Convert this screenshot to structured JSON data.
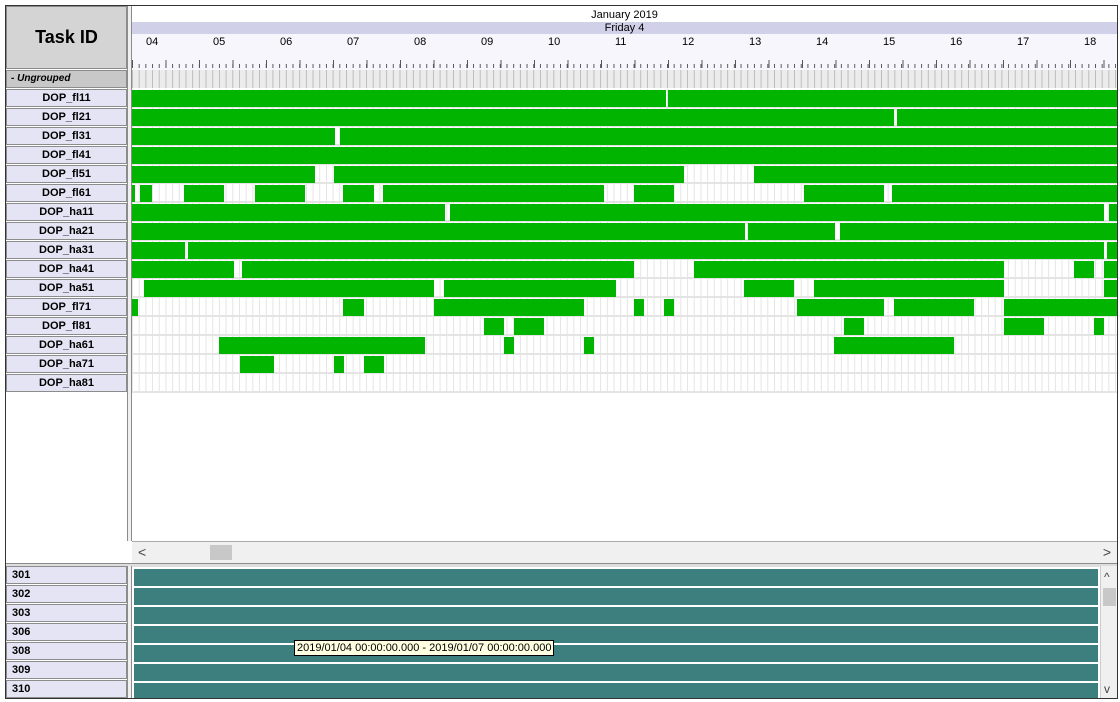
{
  "header": {
    "task_id_label": "Task ID"
  },
  "timeline": {
    "month": "January 2019",
    "day": "Friday 4",
    "hours": [
      "04",
      "05",
      "06",
      "07",
      "08",
      "09",
      "10",
      "11",
      "12",
      "13",
      "14",
      "15",
      "16",
      "17",
      "18"
    ]
  },
  "group": {
    "label": "- Ungrouped"
  },
  "tasks": [
    {
      "id": "DOP_fl11",
      "bars": [
        [
          0,
          534
        ],
        [
          536,
          985
        ]
      ]
    },
    {
      "id": "DOP_fl21",
      "bars": [
        [
          0,
          762
        ],
        [
          765,
          985
        ]
      ]
    },
    {
      "id": "DOP_fl31",
      "bars": [
        [
          0,
          203
        ],
        [
          208,
          985
        ]
      ]
    },
    {
      "id": "DOP_fl41",
      "bars": [
        [
          0,
          985
        ]
      ]
    },
    {
      "id": "DOP_fl51",
      "bars": [
        [
          0,
          183
        ],
        [
          202,
          552
        ],
        [
          622,
          985
        ]
      ]
    },
    {
      "id": "DOP_fl61",
      "bars": [
        [
          0,
          3
        ],
        [
          8,
          20
        ],
        [
          52,
          92
        ],
        [
          123,
          173
        ],
        [
          211,
          242
        ],
        [
          251,
          472
        ],
        [
          502,
          542
        ],
        [
          672,
          752
        ],
        [
          760,
          985
        ]
      ]
    },
    {
      "id": "DOP_ha11",
      "bars": [
        [
          0,
          313
        ],
        [
          318,
          972
        ],
        [
          977,
          985
        ]
      ]
    },
    {
      "id": "DOP_ha21",
      "bars": [
        [
          0,
          613
        ],
        [
          616,
          703
        ],
        [
          708,
          985
        ]
      ]
    },
    {
      "id": "DOP_ha31",
      "bars": [
        [
          0,
          53
        ],
        [
          56,
          972
        ],
        [
          975,
          985
        ]
      ]
    },
    {
      "id": "DOP_ha41",
      "bars": [
        [
          0,
          102
        ],
        [
          110,
          502
        ],
        [
          562,
          872
        ],
        [
          942,
          962
        ],
        [
          972,
          985
        ]
      ]
    },
    {
      "id": "DOP_ha51",
      "bars": [
        [
          12,
          302
        ],
        [
          312,
          484
        ],
        [
          612,
          662
        ],
        [
          682,
          872
        ],
        [
          972,
          985
        ]
      ]
    },
    {
      "id": "DOP_fl71",
      "bars": [
        [
          0,
          6
        ],
        [
          211,
          232
        ],
        [
          302,
          452
        ],
        [
          502,
          512
        ],
        [
          532,
          542
        ],
        [
          665,
          752
        ],
        [
          762,
          842
        ],
        [
          872,
          985
        ]
      ]
    },
    {
      "id": "DOP_fl81",
      "bars": [
        [
          352,
          372
        ],
        [
          382,
          412
        ],
        [
          712,
          732
        ],
        [
          872,
          912
        ],
        [
          962,
          972
        ]
      ]
    },
    {
      "id": "DOP_ha61",
      "bars": [
        [
          87,
          293
        ],
        [
          372,
          382
        ],
        [
          452,
          462
        ],
        [
          702,
          822
        ]
      ]
    },
    {
      "id": "DOP_ha71",
      "bars": [
        [
          108,
          142
        ],
        [
          202,
          212
        ],
        [
          232,
          252
        ]
      ]
    },
    {
      "id": "DOP_ha81",
      "bars": []
    }
  ],
  "resources": [
    "301",
    "302",
    "303",
    "306",
    "308",
    "309",
    "310"
  ],
  "tooltip": "2019/01/04 00:00:00.000 - 2019/01/07 00:00:00.000",
  "scroll": {
    "left": "<",
    "right": ">",
    "up": "^",
    "down": "v"
  },
  "colors": {
    "task_bar": "#00b400",
    "resource_bar": "#3d7f7f"
  }
}
